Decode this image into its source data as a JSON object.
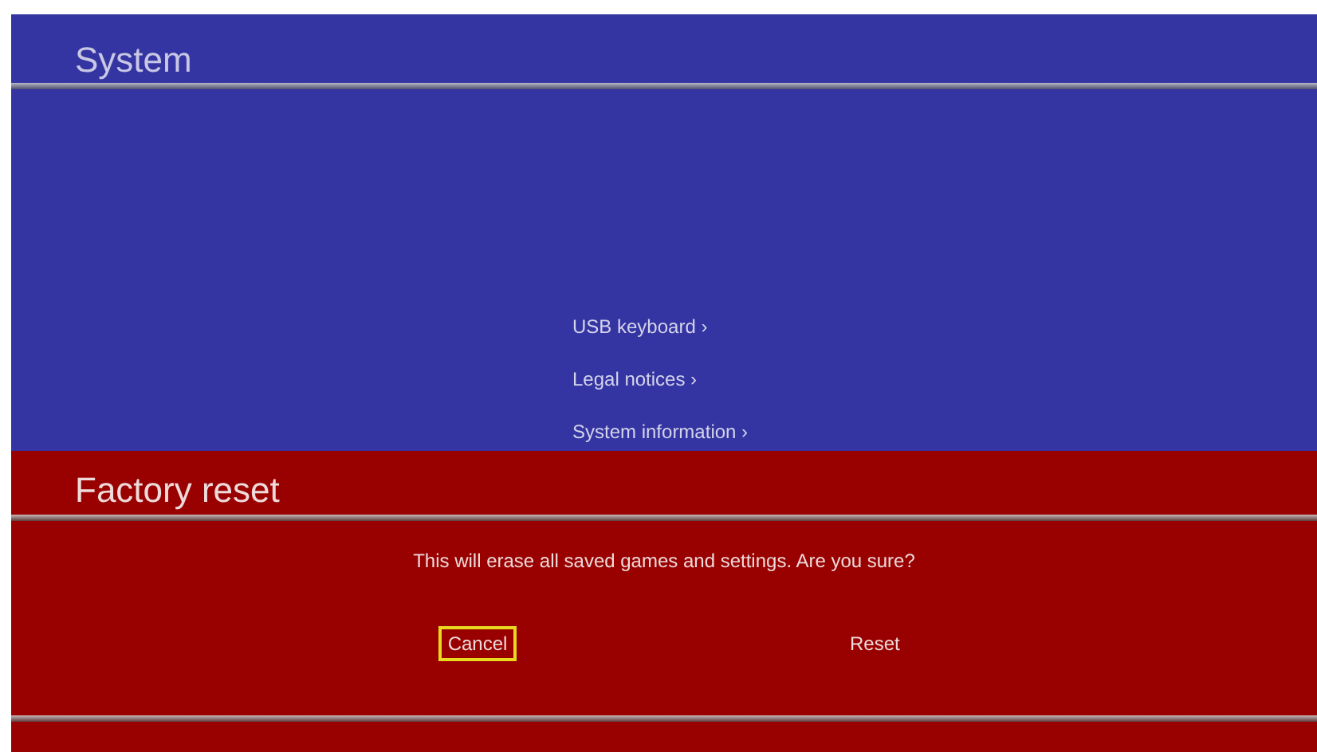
{
  "system_panel": {
    "title": "System",
    "menu_items": [
      {
        "label": "USB keyboard ›"
      },
      {
        "label": "Legal notices ›"
      },
      {
        "label": "System information ›"
      }
    ]
  },
  "dialog": {
    "title": "Factory reset",
    "message": "This will erase all saved games and settings. Are you sure?",
    "buttons": [
      {
        "label": "Cancel",
        "selected": true
      },
      {
        "label": "Reset",
        "selected": false
      }
    ]
  }
}
